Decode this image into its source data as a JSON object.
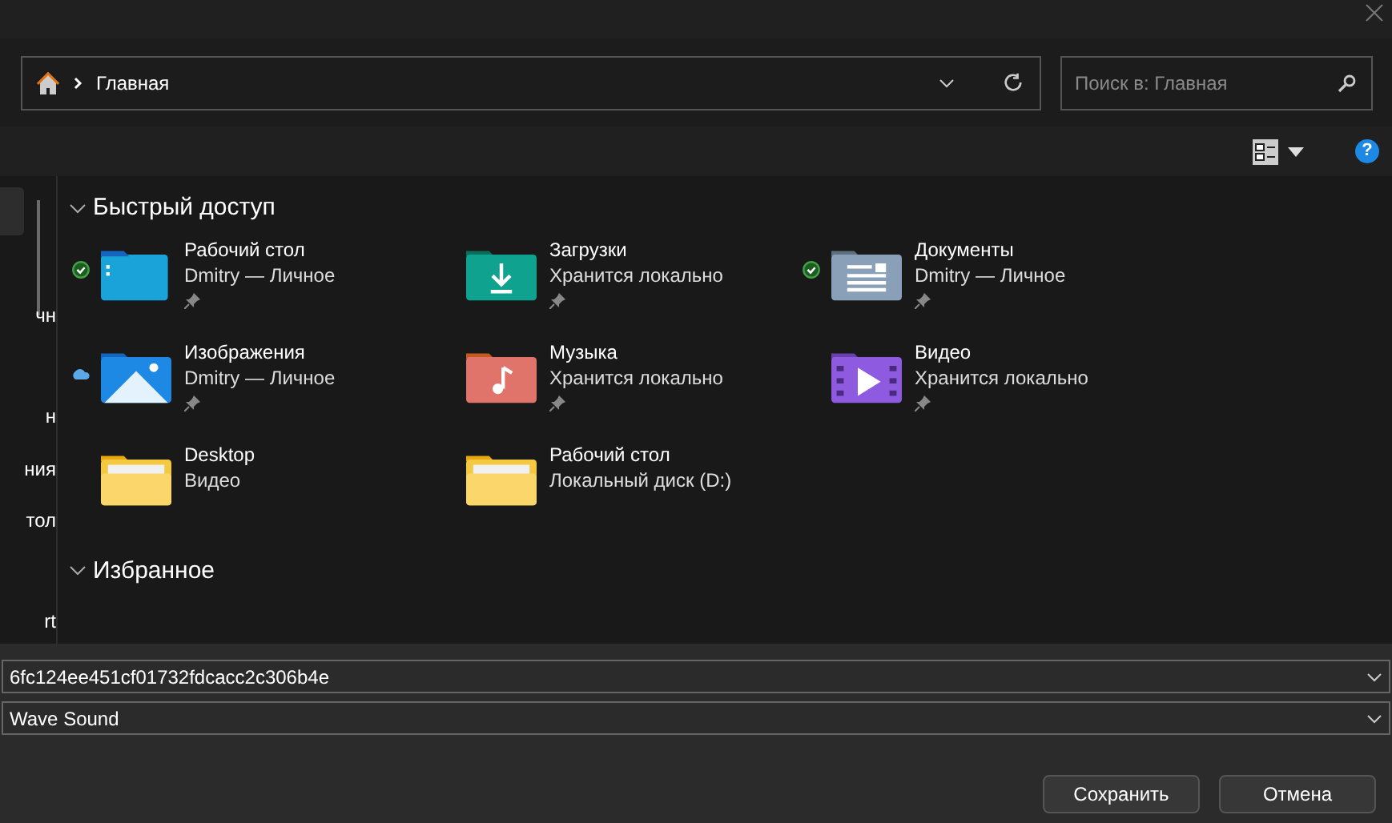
{
  "address_bar": {
    "path": "Главная"
  },
  "search": {
    "placeholder": "Поиск в: Главная"
  },
  "help": {
    "label": "?"
  },
  "sidebar": {
    "items": [
      "чн",
      "н",
      "ния",
      "тол",
      "rt"
    ]
  },
  "sections": [
    {
      "title": "Быстрый доступ",
      "expanded": true,
      "items": [
        {
          "name": "Рабочий стол",
          "detail": "Dmitry — Личное",
          "kind": "desktop",
          "synced": true,
          "in_cloud": false,
          "pinned": true
        },
        {
          "name": "Загрузки",
          "detail": "Хранится локально",
          "kind": "downloads",
          "synced": false,
          "in_cloud": false,
          "pinned": true
        },
        {
          "name": "Документы",
          "detail": "Dmitry — Личное",
          "kind": "documents",
          "synced": true,
          "in_cloud": false,
          "pinned": true
        },
        {
          "name": "Изображения",
          "detail": "Dmitry — Личное",
          "kind": "pictures",
          "synced": false,
          "in_cloud": true,
          "pinned": true
        },
        {
          "name": "Музыка",
          "detail": "Хранится локально",
          "kind": "music",
          "synced": false,
          "in_cloud": false,
          "pinned": true
        },
        {
          "name": "Видео",
          "detail": "Хранится локально",
          "kind": "videos",
          "synced": false,
          "in_cloud": false,
          "pinned": true
        },
        {
          "name": "Desktop",
          "detail": "Видео",
          "kind": "plain",
          "synced": false,
          "in_cloud": false,
          "pinned": false
        },
        {
          "name": "Рабочий стол",
          "detail": "Локальный диск (D:)",
          "kind": "plain",
          "synced": false,
          "in_cloud": false,
          "pinned": false
        }
      ]
    },
    {
      "title": "Избранное",
      "expanded": true
    }
  ],
  "file_name": {
    "value": "6fc124ee451cf01732fdcacc2c306b4e"
  },
  "file_type": {
    "value": "Wave Sound"
  },
  "buttons": [
    "Сохранить",
    "Отмена"
  ]
}
